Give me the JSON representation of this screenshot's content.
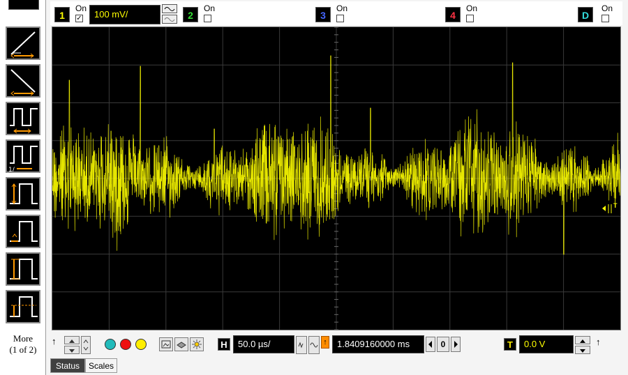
{
  "channels": [
    {
      "number": "1",
      "on_label": "On",
      "checked": true,
      "color": "#ffff00"
    },
    {
      "number": "2",
      "on_label": "On",
      "checked": false,
      "color": "#33dd33"
    },
    {
      "number": "3",
      "on_label": "On",
      "checked": false,
      "color": "#4466ff"
    },
    {
      "number": "4",
      "on_label": "On",
      "checked": false,
      "color": "#ff3344"
    },
    {
      "number": "D",
      "on_label": "On",
      "checked": false,
      "color": "#33dddd"
    }
  ],
  "vertical_scale": "100 mV/",
  "left_panel": {
    "measurement_icons": [
      "rise-time-icon",
      "fall-time-icon",
      "period-icon",
      "frequency-icon",
      "positive-width-icon",
      "negative-width-icon",
      "amplitude-icon",
      "top-level-icon"
    ],
    "more_line1": "More",
    "more_line2": "(1 of 2)"
  },
  "horizontal": {
    "label": "H",
    "scale": "50.0 µs/",
    "position": "1.8409160000 ms",
    "step_value": "0"
  },
  "trigger": {
    "label": "T",
    "level": "0.0 V",
    "marker": "T"
  },
  "tabs": [
    {
      "label": "Status",
      "active": true
    },
    {
      "label": "Scales",
      "active": false
    }
  ],
  "colors": {
    "waveform": "#ffff00",
    "grid": "#3a3a3a",
    "screen_bg": "#000000",
    "trigger_marker": "#ff8c00"
  }
}
